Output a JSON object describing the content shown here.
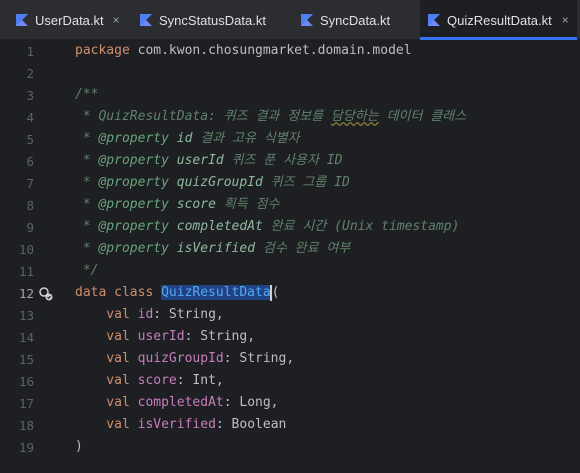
{
  "tabs": [
    {
      "label": "UserData.kt",
      "closable": true,
      "active": false
    },
    {
      "label": "SyncStatusData.kt",
      "closable": true,
      "active": false
    },
    {
      "label": "SyncData.kt",
      "closable": true,
      "active": false
    },
    {
      "label": "QuizResultData.kt",
      "closable": true,
      "active": true
    }
  ],
  "close_glyph": "×",
  "line_numbers": [
    "1",
    "2",
    "3",
    "4",
    "5",
    "6",
    "7",
    "8",
    "9",
    "10",
    "11",
    "12",
    "13",
    "14",
    "15",
    "16",
    "17",
    "18",
    "19"
  ],
  "current_line": "12",
  "code": {
    "l1_kw": "package",
    "l1_rest": " com.kwon.chosungmarket.domain.model",
    "l3": "/**",
    "l4_a": " * QuizResultData: 퀴즈 결과 정보를 ",
    "l4_b": "담당하는",
    "l4_c": " 데이터 클래스",
    "l5_star": " * ",
    "l5_tag": "@property",
    "l5_param": " id",
    "l5_desc": " 결과 고유 식별자",
    "l6_star": " * ",
    "l6_tag": "@property",
    "l6_param": " userId",
    "l6_desc": " 퀴즈 푼 사용자 ID",
    "l7_star": " * ",
    "l7_tag": "@property",
    "l7_param": " quizGroupId",
    "l7_desc": " 퀴즈 그룹 ID",
    "l8_star": " * ",
    "l8_tag": "@property",
    "l8_param": " score",
    "l8_desc": " 획득 점수",
    "l9_star": " * ",
    "l9_tag": "@property",
    "l9_param": " completedAt",
    "l9_desc": " 완료 시간 (Unix timestamp)",
    "l10_star": " * ",
    "l10_tag": "@property",
    "l10_param": " isVerified",
    "l10_desc": " 검수 완료 여부",
    "l11": " */",
    "l12_kw": "data class ",
    "l12_cls": "QuizResultData",
    "l12_rest": "(",
    "l13_kw": "    val ",
    "l13_prop": "id",
    "l13_rest": ": String,",
    "l14_kw": "    val ",
    "l14_prop": "userId",
    "l14_rest": ": String,",
    "l15_kw": "    val ",
    "l15_prop": "quizGroupId",
    "l15_rest": ": String,",
    "l16_kw": "    val ",
    "l16_prop": "score",
    "l16_rest": ": Int,",
    "l17_kw": "    val ",
    "l17_prop": "completedAt",
    "l17_rest": ": Long,",
    "l18_kw": "    val ",
    "l18_prop": "isVerified",
    "l18_rest": ": Boolean",
    "l19": ")"
  },
  "colors": {
    "background": "#1e1f22",
    "tabbar": "#2b2d30",
    "accent": "#3574f0",
    "keyword": "#cf8e6d",
    "doc_comment": "#5f826b",
    "property": "#c77dbb",
    "class_name": "#56a8f5"
  },
  "icons": {
    "file": "kotlin-file-icon",
    "gutter": "implementations-icon"
  }
}
